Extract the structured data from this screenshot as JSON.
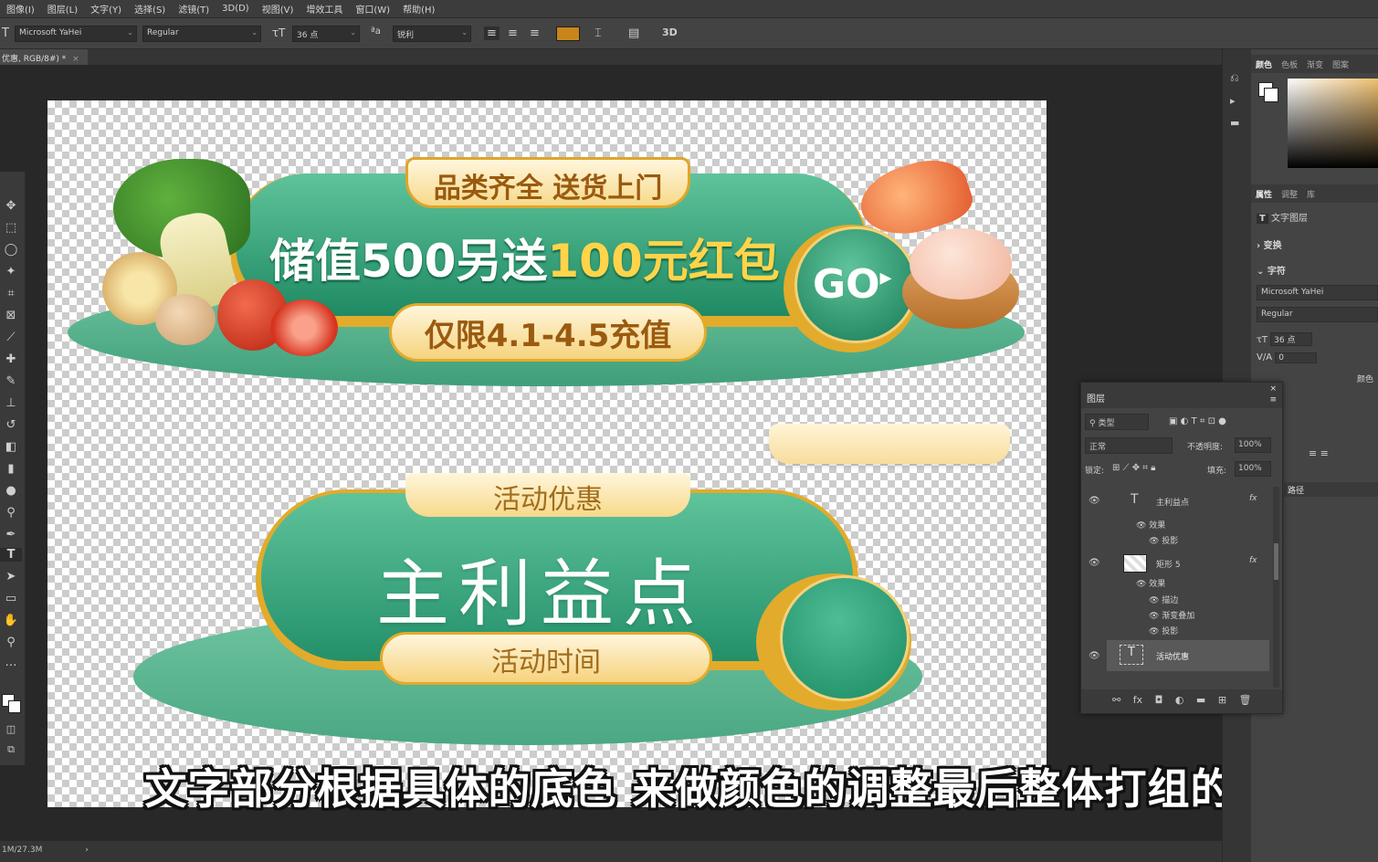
{
  "menu": [
    "图像(I)",
    "图层(L)",
    "文字(Y)",
    "选择(S)",
    "滤镜(T)",
    "3D(D)",
    "视图(V)",
    "增效工具",
    "窗口(W)",
    "帮助(H)"
  ],
  "options": {
    "font_family": "Microsoft YaHei",
    "font_style": "Regular",
    "font_size": "36 点",
    "antialias": "锐利",
    "mode_3d": "3D",
    "text_color": "#c8861a"
  },
  "document": {
    "tab_label": "优惠, RGB/8#) *",
    "status": "1M/27.3M"
  },
  "banner1": {
    "top_tag": "品类齐全 送货上门",
    "headline_white": "储值500另送",
    "headline_gold": "100元红包",
    "go": "GO",
    "date_tag": "仅限4.1-4.5充值"
  },
  "banner2": {
    "top_tag": "活动优惠",
    "headline": "主利益点",
    "bottom_tag": "活动时间"
  },
  "subtitle": "文字部分根据具体的底色 来做颜色的调整最后整体打组的",
  "right_panel": {
    "color_tabs": [
      "颜色",
      "色板",
      "渐变",
      "图案"
    ],
    "prop_tabs": [
      "属性",
      "调整",
      "库"
    ],
    "layer_type": "文字图层",
    "transform": "变换",
    "character": "字符",
    "font_family": "Microsoft YaHei",
    "font_style": "Regular",
    "font_size": "36 点",
    "tracking": "0",
    "paths_tab": "路径",
    "color_label": "颜色"
  },
  "layers_panel": {
    "title": "图层",
    "filter": "类型",
    "blend": "正常",
    "opacity_label": "不透明度:",
    "opacity": "100%",
    "lock_label": "锁定:",
    "fill_label": "填充:",
    "fill": "100%",
    "layers": [
      {
        "name": "主利益点",
        "kind": "text",
        "effects_label": "效果",
        "effects": [
          "投影"
        ]
      },
      {
        "name": "矩形 5",
        "kind": "shape",
        "effects_label": "效果",
        "effects": [
          "描边",
          "渐变叠加",
          "投影"
        ]
      },
      {
        "name": "活动优惠",
        "kind": "text",
        "selected": true
      }
    ]
  }
}
